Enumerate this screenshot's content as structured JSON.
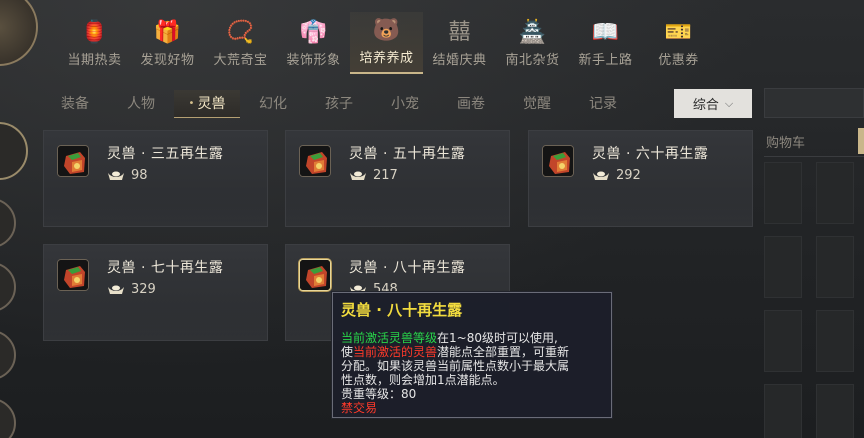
{
  "top_tabs": [
    {
      "label": "当期热卖",
      "icon": "storefront-icon",
      "glyph": "🏮"
    },
    {
      "label": "发现好物",
      "icon": "gift-heart-icon",
      "glyph": "🎁"
    },
    {
      "label": "大荒奇宝",
      "icon": "necklace-icon",
      "glyph": "📿"
    },
    {
      "label": "装饰形象",
      "icon": "costume-icon",
      "glyph": "👘"
    },
    {
      "label": "培养养成",
      "icon": "pet-face-icon",
      "glyph": "🐻",
      "active": true
    },
    {
      "label": "结婚庆典",
      "icon": "double-happiness-icon",
      "glyph": "囍"
    },
    {
      "label": "南北杂货",
      "icon": "shop-roof-icon",
      "glyph": "🏯"
    },
    {
      "label": "新手上路",
      "icon": "book-icon",
      "glyph": "📖"
    },
    {
      "label": "优惠券",
      "icon": "coupon-icon",
      "glyph": "🎫"
    }
  ],
  "sub_tabs": [
    {
      "label": "装备"
    },
    {
      "label": "人物"
    },
    {
      "label": "灵兽",
      "active": true
    },
    {
      "label": "幻化"
    },
    {
      "label": "孩子"
    },
    {
      "label": "小宠"
    },
    {
      "label": "画卷"
    },
    {
      "label": "觉醒"
    },
    {
      "label": "记录"
    }
  ],
  "sort_select": {
    "value": "综合"
  },
  "cart": {
    "title": "购物车"
  },
  "items": [
    {
      "name": "灵兽 · 三五再生露",
      "price": "98"
    },
    {
      "name": "灵兽 · 五十再生露",
      "price": "217"
    },
    {
      "name": "灵兽 · 六十再生露",
      "price": "292"
    },
    {
      "name": "灵兽 · 七十再生露",
      "price": "329"
    },
    {
      "name": "灵兽 · 八十再生露",
      "price": "548"
    }
  ],
  "tooltip": {
    "title": "灵兽 · 八十再生露",
    "line1_green": "当前激活灵兽等级",
    "line1_rest": "在1~80级时可以使用,",
    "line2_pre": "使",
    "line2_red": "当前激活的灵兽",
    "line2_rest": "潜能点全部重置，可重新",
    "line3": "分配。如果该灵兽当前属性点数小于最大属",
    "line4": "性点数，则会增加1点潜能点。",
    "line5": "贵重等级：80",
    "line6_red": "禁交易"
  },
  "colors": {
    "accent_gold": "#c9b68a",
    "tooltip_title": "#f2dc3e",
    "tooltip_green": "#28d64a",
    "tooltip_red": "#ff3a2a"
  }
}
